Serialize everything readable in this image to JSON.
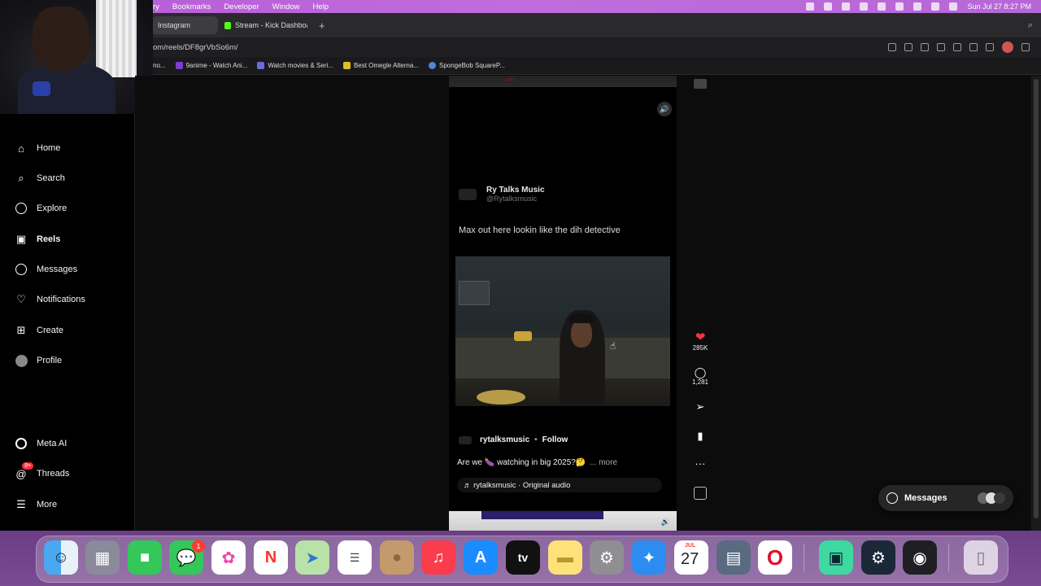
{
  "menubar": {
    "menus": [
      "ry",
      "Bookmarks",
      "Developer",
      "Window",
      "Help"
    ],
    "clock": "Sun Jul 27  8:27 PM"
  },
  "browser": {
    "tabs": [
      {
        "label": "Instagram",
        "active": true
      },
      {
        "label": "Stream - Kick Dashboard",
        "active": false
      }
    ],
    "new_tab": "+",
    "url": "om/reels/DF8grVbSo6m/",
    "bookmarks": [
      "no...",
      "9anime - Watch Ani...",
      "Watch movies & Seri...",
      "Best Omegle Alterna...",
      "SpongeBob SquareP..."
    ]
  },
  "sidebar": {
    "items": [
      {
        "label": "Home",
        "icon": "home-icon"
      },
      {
        "label": "Search",
        "icon": "search-icon"
      },
      {
        "label": "Explore",
        "icon": "compass-icon"
      },
      {
        "label": "Reels",
        "icon": "reels-icon"
      },
      {
        "label": "Messages",
        "icon": "messenger-icon"
      },
      {
        "label": "Notifications",
        "icon": "heart-icon"
      },
      {
        "label": "Create",
        "icon": "plus-square-icon"
      },
      {
        "label": "Profile",
        "icon": "avatar-icon"
      },
      {
        "label": "Meta AI",
        "icon": "meta-ai-icon"
      },
      {
        "label": "Threads",
        "icon": "threads-icon",
        "badge": "9+"
      },
      {
        "label": "More",
        "icon": "hamburger-icon"
      }
    ]
  },
  "reel": {
    "tweet_name": "Ry Talks Music",
    "tweet_handle": "@Rytalksmusic",
    "tweet_text": "Max out here lookin like the dih detective",
    "username": "rytalksmusic",
    "dot": "•",
    "follow": "Follow",
    "caption": "Are we 🍆 watching in big 2025?🤔",
    "caption_more": "... more",
    "audio": "♬ rytalksmusic · Original audio"
  },
  "actions": {
    "likes": "285K",
    "comments": "1,281"
  },
  "messages_pill": {
    "label": "Messages"
  },
  "dock": {
    "messages_badge": "1",
    "calendar_month": "JUL",
    "calendar_day": "27"
  },
  "colors": {
    "ig_bg": "#000000",
    "like_red": "#ff3040",
    "menubar": "#c06cdc"
  }
}
